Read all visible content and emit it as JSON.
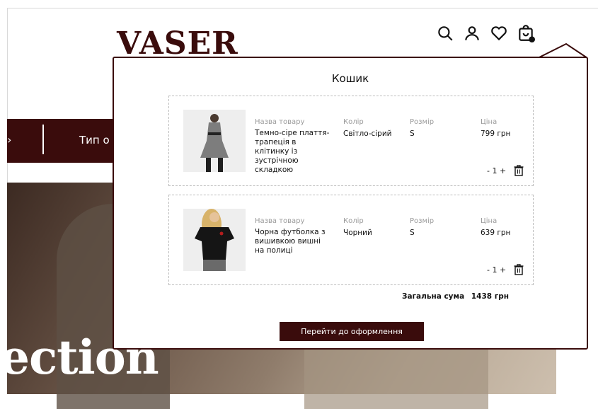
{
  "brand": {
    "logo": "VASER"
  },
  "header": {
    "icons": [
      "search-icon",
      "user-icon",
      "heart-icon",
      "cart-icon"
    ]
  },
  "nav": {
    "arrow": "›",
    "label": "Тип о"
  },
  "hero": {
    "text": "ection"
  },
  "cart": {
    "title": "Кошик",
    "column_labels": {
      "name": "Назва товару",
      "color": "Колір",
      "size": "Розмір",
      "price": "Ціна"
    },
    "items": [
      {
        "name": "Темно-сіре плаття-трапеція в клітинку із зустрічною складкою",
        "color": "Світло-сірий",
        "size": "S",
        "price": "799 грн",
        "qty": "- 1 +"
      },
      {
        "name": "Чорна футболка з вишивкою вишні на полиці",
        "color": "Чорний",
        "size": "S",
        "price": "639 грн",
        "qty": "- 1 +"
      }
    ],
    "total_label": "Загальна сума",
    "total_value": "1438 грн",
    "checkout_label": "Перейти до оформлення"
  },
  "colors": {
    "accent": "#3a0c0c",
    "border": "#bcbcbc"
  }
}
